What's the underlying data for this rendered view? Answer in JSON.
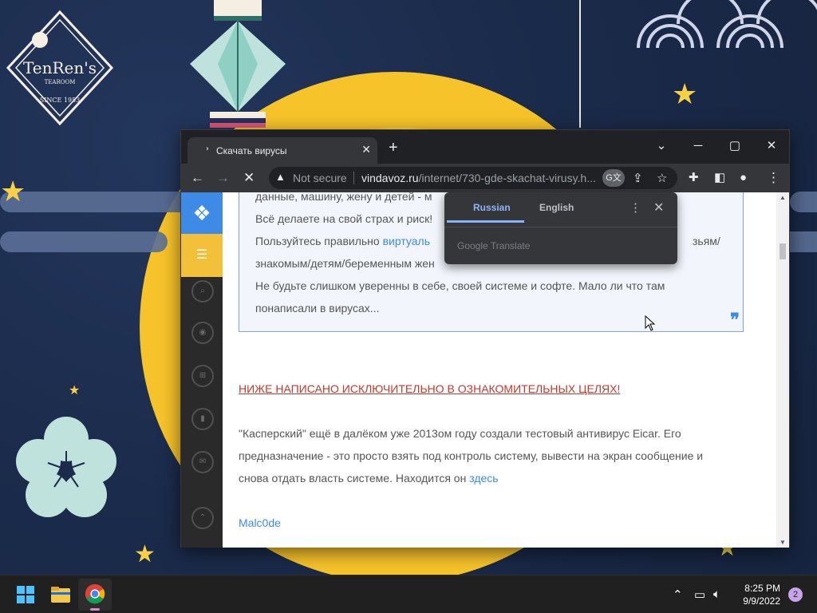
{
  "desktop": {
    "logo": {
      "name": "TenRen's",
      "subtitle": "TEAROOM",
      "since": "SINCE 1953"
    }
  },
  "browser": {
    "tab": {
      "title": "Скачать вирусы",
      "close": "✕"
    },
    "new_tab": "+",
    "window": {
      "minimize": "─",
      "maximize": "▢",
      "close": "✕",
      "tab_search": "⌄"
    },
    "toolbar": {
      "back": "←",
      "forward": "→",
      "stop": "✕",
      "security_label": "Not secure",
      "url_domain": "vindavoz.ru",
      "url_path": "/internet/730-gde-skachat-virusy.h..."
    },
    "translate_popup": {
      "source_language": "Russian",
      "target_language": "English",
      "more": "⋮",
      "close": "✕",
      "branding": "Google Translate"
    }
  },
  "page": {
    "quote_lines": [
      "данные, машину, жену и детей - м",
      "Всё делаете на свой страх и риск!",
      "Пользуйтесь правильно",
      "знакомым/детям/беременным жен",
      "Не будьте слишком уверенны в себе, своей системе и софте. Мало ли что там",
      "понаписали в вирусах..."
    ],
    "quote_link": "виртуаль",
    "quote_tail": "зьям/",
    "quote_mark": "❞",
    "warning_link": "НИЖЕ НАПИСАНО ИСКЛЮЧИТЕЛЬНО В ОЗНАКОМИТЕЛЬНЫХ ЦЕЛЯХ!",
    "paragraph_lines": [
      "\"Касперский\" ещё в далёком уже 2013ом году создали тестовый антивирус Eicar. Его",
      "предназначение - это просто взять под контроль систему, вывести на экран сообщение и",
      "снова отдать власть системе. Находится он"
    ],
    "paragraph_link": "здесь",
    "section_link": "Malc0de"
  },
  "taskbar": {
    "time": "8:25 PM",
    "date": "9/9/2022",
    "notification_count": "2"
  }
}
